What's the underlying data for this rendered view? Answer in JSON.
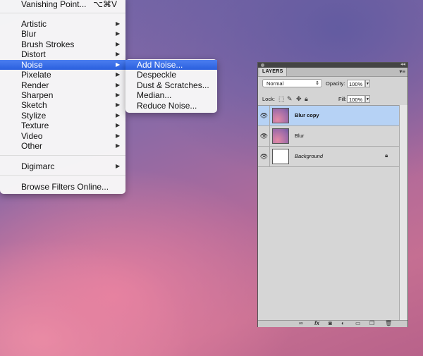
{
  "filter_menu": {
    "top_item": {
      "label": "Vanishing Point...",
      "shortcut": "⌥⌘V"
    },
    "items": [
      {
        "label": "Artistic"
      },
      {
        "label": "Blur"
      },
      {
        "label": "Brush Strokes"
      },
      {
        "label": "Distort"
      },
      {
        "label": "Noise"
      },
      {
        "label": "Pixelate"
      },
      {
        "label": "Render"
      },
      {
        "label": "Sharpen"
      },
      {
        "label": "Sketch"
      },
      {
        "label": "Stylize"
      },
      {
        "label": "Texture"
      },
      {
        "label": "Video"
      },
      {
        "label": "Other"
      }
    ],
    "digimarc": {
      "label": "Digimarc"
    },
    "browse": {
      "label": "Browse Filters Online..."
    },
    "highlighted": "Noise",
    "submenu_arrow": "▶"
  },
  "noise_submenu": {
    "items": [
      {
        "label": "Add Noise..."
      },
      {
        "label": "Despeckle"
      },
      {
        "label": "Dust & Scratches..."
      },
      {
        "label": "Median..."
      },
      {
        "label": "Reduce Noise..."
      }
    ],
    "highlighted": "Add Noise..."
  },
  "layers_panel": {
    "tab": "LAYERS",
    "blend_mode": "Normal",
    "opacity_label": "Opacity:",
    "opacity": "100%",
    "lock_label": "Lock:",
    "fill_label": "Fill:",
    "fill": "100%",
    "layers": [
      {
        "name": "Blur copy",
        "selected": true,
        "thumb": "pink"
      },
      {
        "name": "Blur",
        "selected": false,
        "thumb": "pink"
      },
      {
        "name": "Background",
        "selected": false,
        "thumb": "white",
        "locked": true
      }
    ],
    "footer_icons": [
      "link-icon",
      "fx-icon",
      "mask-icon",
      "adjustment-icon",
      "folder-icon",
      "new-layer-icon",
      "trash-icon"
    ]
  },
  "colors": {
    "highlight": "#2f63e0",
    "selected_layer": "#b6d2f5"
  }
}
